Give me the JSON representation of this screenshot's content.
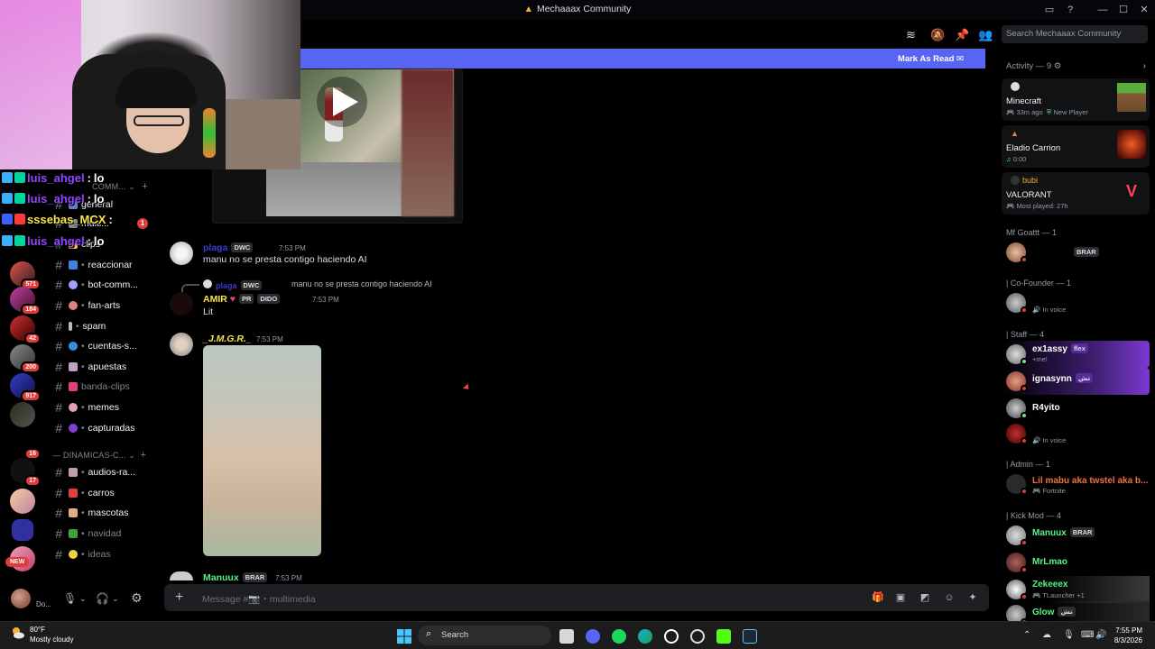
{
  "window": {
    "title": "Mechaaax Community"
  },
  "header": {
    "search_placeholder": "Search Mechaaax Community"
  },
  "readbar": {
    "label": "Mark As Read"
  },
  "overlay_chat": [
    {
      "user": "luis_ahgel",
      "color": "#9146ff",
      "msg": "lo"
    },
    {
      "user": "luis_ahgel",
      "color": "#9146ff",
      "msg": "lo"
    },
    {
      "user": "sssebas_MCX",
      "color": "#f7e447",
      "msg": ""
    },
    {
      "user": "luis_ahgel",
      "color": "#9146ff",
      "msg": "lo"
    }
  ],
  "rail": {
    "badges": [
      "571",
      "184",
      "42",
      "200",
      "917",
      "16",
      "17"
    ],
    "new_label": "NEW"
  },
  "channels": {
    "category_top": "COMM...",
    "items_top": [
      {
        "name": "general",
        "muted": false
      },
      {
        "name": "multi...",
        "muted": false,
        "unread": "1"
      },
      {
        "name": "clips",
        "muted": false
      },
      {
        "name": "reaccionar",
        "muted": false
      },
      {
        "name": "bot-comm...",
        "muted": false
      },
      {
        "name": "fan-arts",
        "muted": false
      },
      {
        "name": "spam",
        "muted": false
      },
      {
        "name": "cuentas-s...",
        "muted": false
      },
      {
        "name": "apuestas",
        "muted": false
      },
      {
        "name": "banda-clips",
        "muted": true
      },
      {
        "name": "memes",
        "muted": false
      },
      {
        "name": "capturadas",
        "muted": false
      }
    ],
    "category_2": "DINAMICAS-C...",
    "items_2": [
      {
        "name": "audios-ra...",
        "muted": false
      },
      {
        "name": "carros",
        "muted": false
      },
      {
        "name": "mascotas",
        "muted": false
      },
      {
        "name": "navidad",
        "muted": true
      },
      {
        "name": "ideas",
        "muted": true
      }
    ]
  },
  "userpanel": {
    "name": "",
    "status": "Do..."
  },
  "messages": {
    "msg1": {
      "author": "plaga",
      "tag": "DWC",
      "time": "7:53 PM",
      "text": "manu no se presta contigo haciendo AI"
    },
    "msg2": {
      "reply_author": "plaga",
      "reply_tag": "DWC",
      "reply_text": "manu no se presta contigo haciendo AI",
      "author": "AMIR",
      "tag1": "PR",
      "tag2": "DIDO",
      "time": "7:53 PM",
      "text": "Lit"
    },
    "msg3": {
      "author": "_J.M.G.R._",
      "time": "7:53 PM"
    },
    "msg4": {
      "author": "Manuux",
      "tag": "BRAR",
      "time": "7:53 PM"
    }
  },
  "composer": {
    "placeholder": "Message #📷・multimedia"
  },
  "members": {
    "activity_title": "Activity — 9",
    "activities": [
      {
        "who": "",
        "game": "Minecraft",
        "meta1": "33m ago",
        "meta2": "New Player"
      },
      {
        "who": "",
        "game": "Eladio Carrion",
        "meta1": "0:00",
        "meta2": ""
      },
      {
        "who": "bubi",
        "game": "VALORANT",
        "meta1": "Most played: 27h",
        "meta2": ""
      }
    ],
    "groups": [
      {
        "title": "Mf Goattt — 1"
      },
      {
        "title": "| Co-Founder — 1"
      },
      {
        "title": "| Staff — 4"
      },
      {
        "title": "| Admin — 1"
      },
      {
        "title": "| Kick Mod — 4"
      }
    ],
    "list": [
      {
        "name": "",
        "tag": "BRAR",
        "status": ""
      },
      {
        "name": "",
        "status": "In voice"
      },
      {
        "name": "ex1assy",
        "tag": "flex",
        "status": "+me!"
      },
      {
        "name": "ignasynn",
        "tag": "تش",
        "status": ""
      },
      {
        "name": "R4yito",
        "status": ""
      },
      {
        "name": "",
        "status": "In voice"
      },
      {
        "name": "Lil mabu aka twstel aka b...",
        "status": "Fortnite"
      },
      {
        "name": "Manuux",
        "tag": "BRAR",
        "status": ""
      },
      {
        "name": "MrLmao",
        "status": ""
      },
      {
        "name": "Zekeeex",
        "status": "TLauncher +1"
      },
      {
        "name": "Glow",
        "tag": "تش",
        "status": ""
      }
    ]
  },
  "taskbar": {
    "temp": "80°F",
    "condition": "Mostly cloudy",
    "search": "Search",
    "time": "7:55 PM",
    "date": "8/3/2026"
  }
}
